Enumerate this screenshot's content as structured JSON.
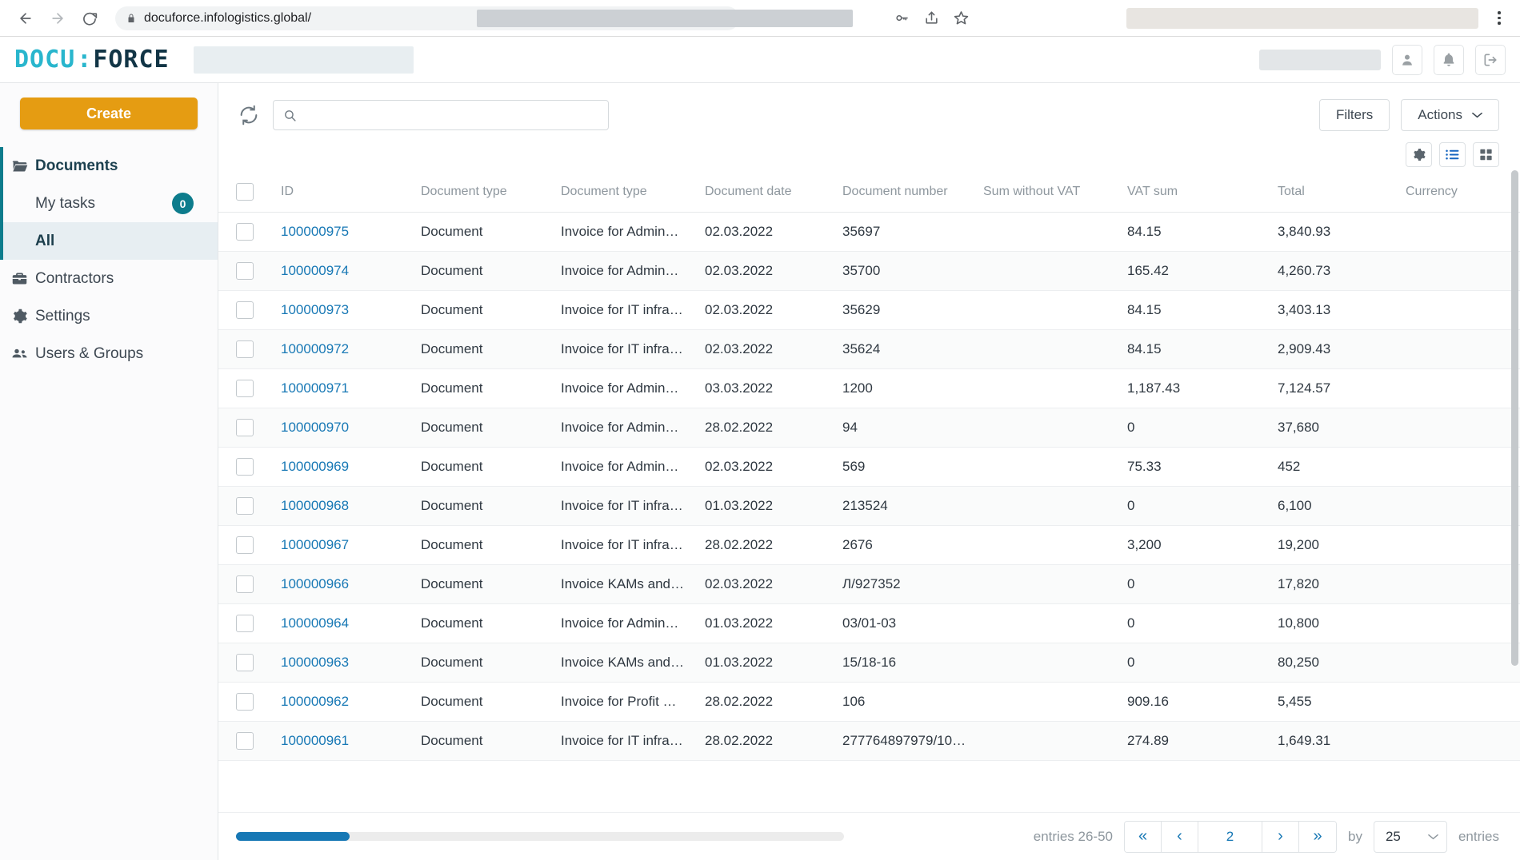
{
  "browser": {
    "url": "docuforce.infologistics.global/",
    "back_label": "Back",
    "forward_label": "Forward",
    "reload_label": "Reload"
  },
  "app_header": {
    "logo_docu": "DOCU",
    "logo_sep": ":",
    "logo_force": "FORCE"
  },
  "sidebar": {
    "create_label": "Create",
    "items": [
      {
        "label": "Documents",
        "icon": "folder-icon"
      },
      {
        "label": "My tasks",
        "icon": "",
        "badge": "0"
      },
      {
        "label": "All",
        "icon": ""
      },
      {
        "label": "Contractors",
        "icon": "briefcase-icon"
      },
      {
        "label": "Settings",
        "icon": "gear-icon"
      },
      {
        "label": "Users & Groups",
        "icon": "users-icon"
      }
    ]
  },
  "toolbar": {
    "search_placeholder": "",
    "search_value": "",
    "filters_label": "Filters",
    "actions_label": "Actions",
    "refresh_icon": "refresh-icon",
    "settings_icon": "gear-icon",
    "list_view_icon": "list-view-icon",
    "grid_view_icon": "grid-view-icon"
  },
  "table": {
    "columns": [
      "ID",
      "Document type",
      "Document type",
      "Document date",
      "Document number",
      "Sum without VAT",
      "VAT sum",
      "Total",
      "Currency"
    ],
    "rows": [
      {
        "id": "100000975",
        "type1": "Document",
        "type2": "Invoice for Admin…",
        "date": "02.03.2022",
        "number": "35697",
        "sum": "",
        "vat": "84.15",
        "total": "3,840.93",
        "currency": ""
      },
      {
        "id": "100000974",
        "type1": "Document",
        "type2": "Invoice for Admin…",
        "date": "02.03.2022",
        "number": "35700",
        "sum": "",
        "vat": "165.42",
        "total": "4,260.73",
        "currency": ""
      },
      {
        "id": "100000973",
        "type1": "Document",
        "type2": "Invoice for IT infra…",
        "date": "02.03.2022",
        "number": "35629",
        "sum": "",
        "vat": "84.15",
        "total": "3,403.13",
        "currency": ""
      },
      {
        "id": "100000972",
        "type1": "Document",
        "type2": "Invoice for IT infra…",
        "date": "02.03.2022",
        "number": "35624",
        "sum": "",
        "vat": "84.15",
        "total": "2,909.43",
        "currency": ""
      },
      {
        "id": "100000971",
        "type1": "Document",
        "type2": "Invoice for Admin…",
        "date": "03.03.2022",
        "number": "1200",
        "sum": "",
        "vat": "1,187.43",
        "total": "7,124.57",
        "currency": ""
      },
      {
        "id": "100000970",
        "type1": "Document",
        "type2": "Invoice for Admin…",
        "date": "28.02.2022",
        "number": "94",
        "sum": "",
        "vat": "0",
        "total": "37,680",
        "currency": ""
      },
      {
        "id": "100000969",
        "type1": "Document",
        "type2": "Invoice for Admin…",
        "date": "02.03.2022",
        "number": "569",
        "sum": "",
        "vat": "75.33",
        "total": "452",
        "currency": ""
      },
      {
        "id": "100000968",
        "type1": "Document",
        "type2": "Invoice for IT infra…",
        "date": "01.03.2022",
        "number": "213524",
        "sum": "",
        "vat": "0",
        "total": "6,100",
        "currency": ""
      },
      {
        "id": "100000967",
        "type1": "Document",
        "type2": "Invoice for IT infra…",
        "date": "28.02.2022",
        "number": "2676",
        "sum": "",
        "vat": "3,200",
        "total": "19,200",
        "currency": ""
      },
      {
        "id": "100000966",
        "type1": "Document",
        "type2": "Invoice KAMs and…",
        "date": "02.03.2022",
        "number": "Л/927352",
        "sum": "",
        "vat": "0",
        "total": "17,820",
        "currency": ""
      },
      {
        "id": "100000964",
        "type1": "Document",
        "type2": "Invoice for Admin…",
        "date": "01.03.2022",
        "number": "03/01-03",
        "sum": "",
        "vat": "0",
        "total": "10,800",
        "currency": ""
      },
      {
        "id": "100000963",
        "type1": "Document",
        "type2": "Invoice KAMs and…",
        "date": "01.03.2022",
        "number": "15/18-16",
        "sum": "",
        "vat": "0",
        "total": "80,250",
        "currency": ""
      },
      {
        "id": "100000962",
        "type1": "Document",
        "type2": "Invoice for Profit …",
        "date": "28.02.2022",
        "number": "106",
        "sum": "",
        "vat": "909.16",
        "total": "5,455",
        "currency": ""
      },
      {
        "id": "100000961",
        "type1": "Document",
        "type2": "Invoice for IT infra…",
        "date": "28.02.2022",
        "number": "277764897979/10…",
        "sum": "",
        "vat": "274.89",
        "total": "1,649.31",
        "currency": ""
      }
    ]
  },
  "footer": {
    "entries_label": "entries 26-50",
    "first_label": "«",
    "prev_label": "‹",
    "current_page": "2",
    "next_label": "›",
    "last_label": "»",
    "by_label": "by",
    "per_page": "25",
    "entries_suffix": "entries"
  },
  "colors": {
    "accent_teal": "#0d7c8c",
    "brand_cyan": "#29b6cd",
    "brand_navy": "#123546",
    "create_orange": "#e59c12",
    "link_blue": "#1778b5"
  }
}
